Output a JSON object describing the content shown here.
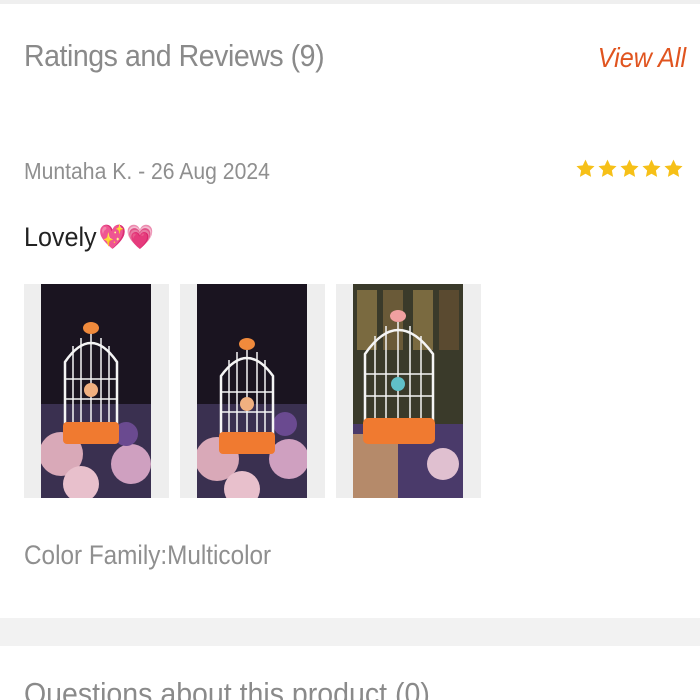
{
  "ratings": {
    "title": "Ratings and Reviews (9)",
    "view_all_label": "View All"
  },
  "review": {
    "author_date": "Muntaha K. - 26 Aug 2024",
    "rating": 5,
    "rating_max": 5,
    "star_color": "#f6c018",
    "text": "Lovely",
    "emoji": "💖💗",
    "photos": [
      {
        "alt": "birdcage-toy-photo-1"
      },
      {
        "alt": "birdcage-toy-photo-2"
      },
      {
        "alt": "birdcage-toy-photo-3"
      }
    ],
    "attribute": "Color Family:Multicolor"
  },
  "questions": {
    "title": "Questions about this product (0)"
  },
  "colors": {
    "accent": "#e0541f",
    "muted_text": "#8f8f8f"
  }
}
